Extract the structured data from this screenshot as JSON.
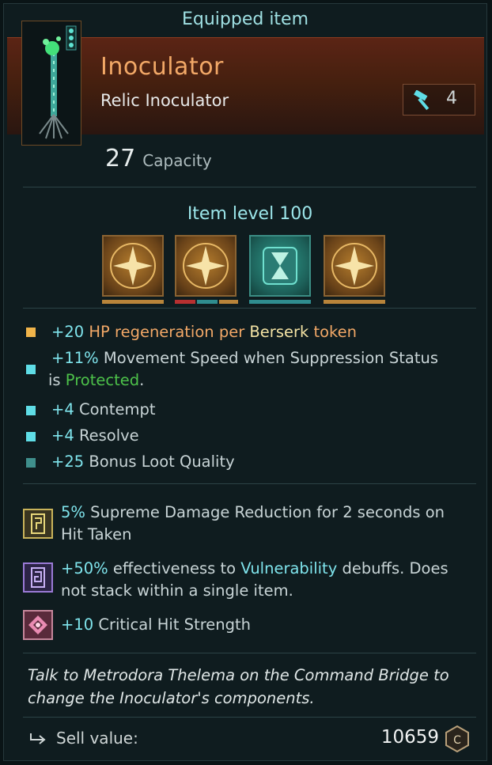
{
  "title": "Equipped item",
  "item": {
    "name": "Inoculator",
    "type": "Relic Inoculator",
    "tier": "4",
    "tier_icon": "hammer-icon",
    "capacity_value": "27",
    "capacity_label": "Capacity",
    "level_text": "Item level 100"
  },
  "slots": [
    {
      "icon": "star-compass-icon",
      "color": "#b37b2c"
    },
    {
      "icon": "star-compass-icon",
      "color": "#b37b2c"
    },
    {
      "icon": "hourglass-icon",
      "color": "#2f9b8b"
    },
    {
      "icon": "star-compass-icon",
      "color": "#b37b2c"
    }
  ],
  "mods": [
    {
      "prefix": "+20",
      "rest_a": "HP regeneration per",
      "highlight": "Berserk",
      "rest_b": "token",
      "bullet_color": "#f0b44a"
    },
    {
      "prefix": "+11%",
      "line1": "Movement Speed when Suppression Status",
      "line2_a": "is",
      "status": "Protected",
      "line2_b": ".",
      "bullet_color": "#5fdde6"
    },
    {
      "prefix": "+4",
      "text": "Contempt",
      "bullet_color": "#5fdde6"
    },
    {
      "prefix": "+4",
      "text": "Resolve",
      "bullet_color": "#5fdde6"
    },
    {
      "prefix": "+25",
      "text": "Bonus Loot Quality",
      "bullet_color": "#3f8f8c"
    }
  ],
  "perks": [
    {
      "icon": "tablet-yellow-icon",
      "value": "5%",
      "line1": "Supreme Damage Reduction for 2 seconds on",
      "line2": "Hit Taken"
    },
    {
      "icon": "tablet-purple-icon",
      "value": "+50%",
      "text_a": "effectiveness to",
      "keyword": "Vulnerability",
      "text_b": "debuffs. Does",
      "line2": "not stack within a single item."
    },
    {
      "icon": "crit-diamond-icon",
      "value": "+10",
      "text": "Critical Hit Strength"
    }
  ],
  "hint": {
    "line1": "Talk to Metrodora Thelema on the Command Bridge to",
    "line2": "change the Inoculator's components."
  },
  "sell": {
    "label": "Sell value:",
    "value": "10659",
    "currency_icon": "credits-icon"
  }
}
